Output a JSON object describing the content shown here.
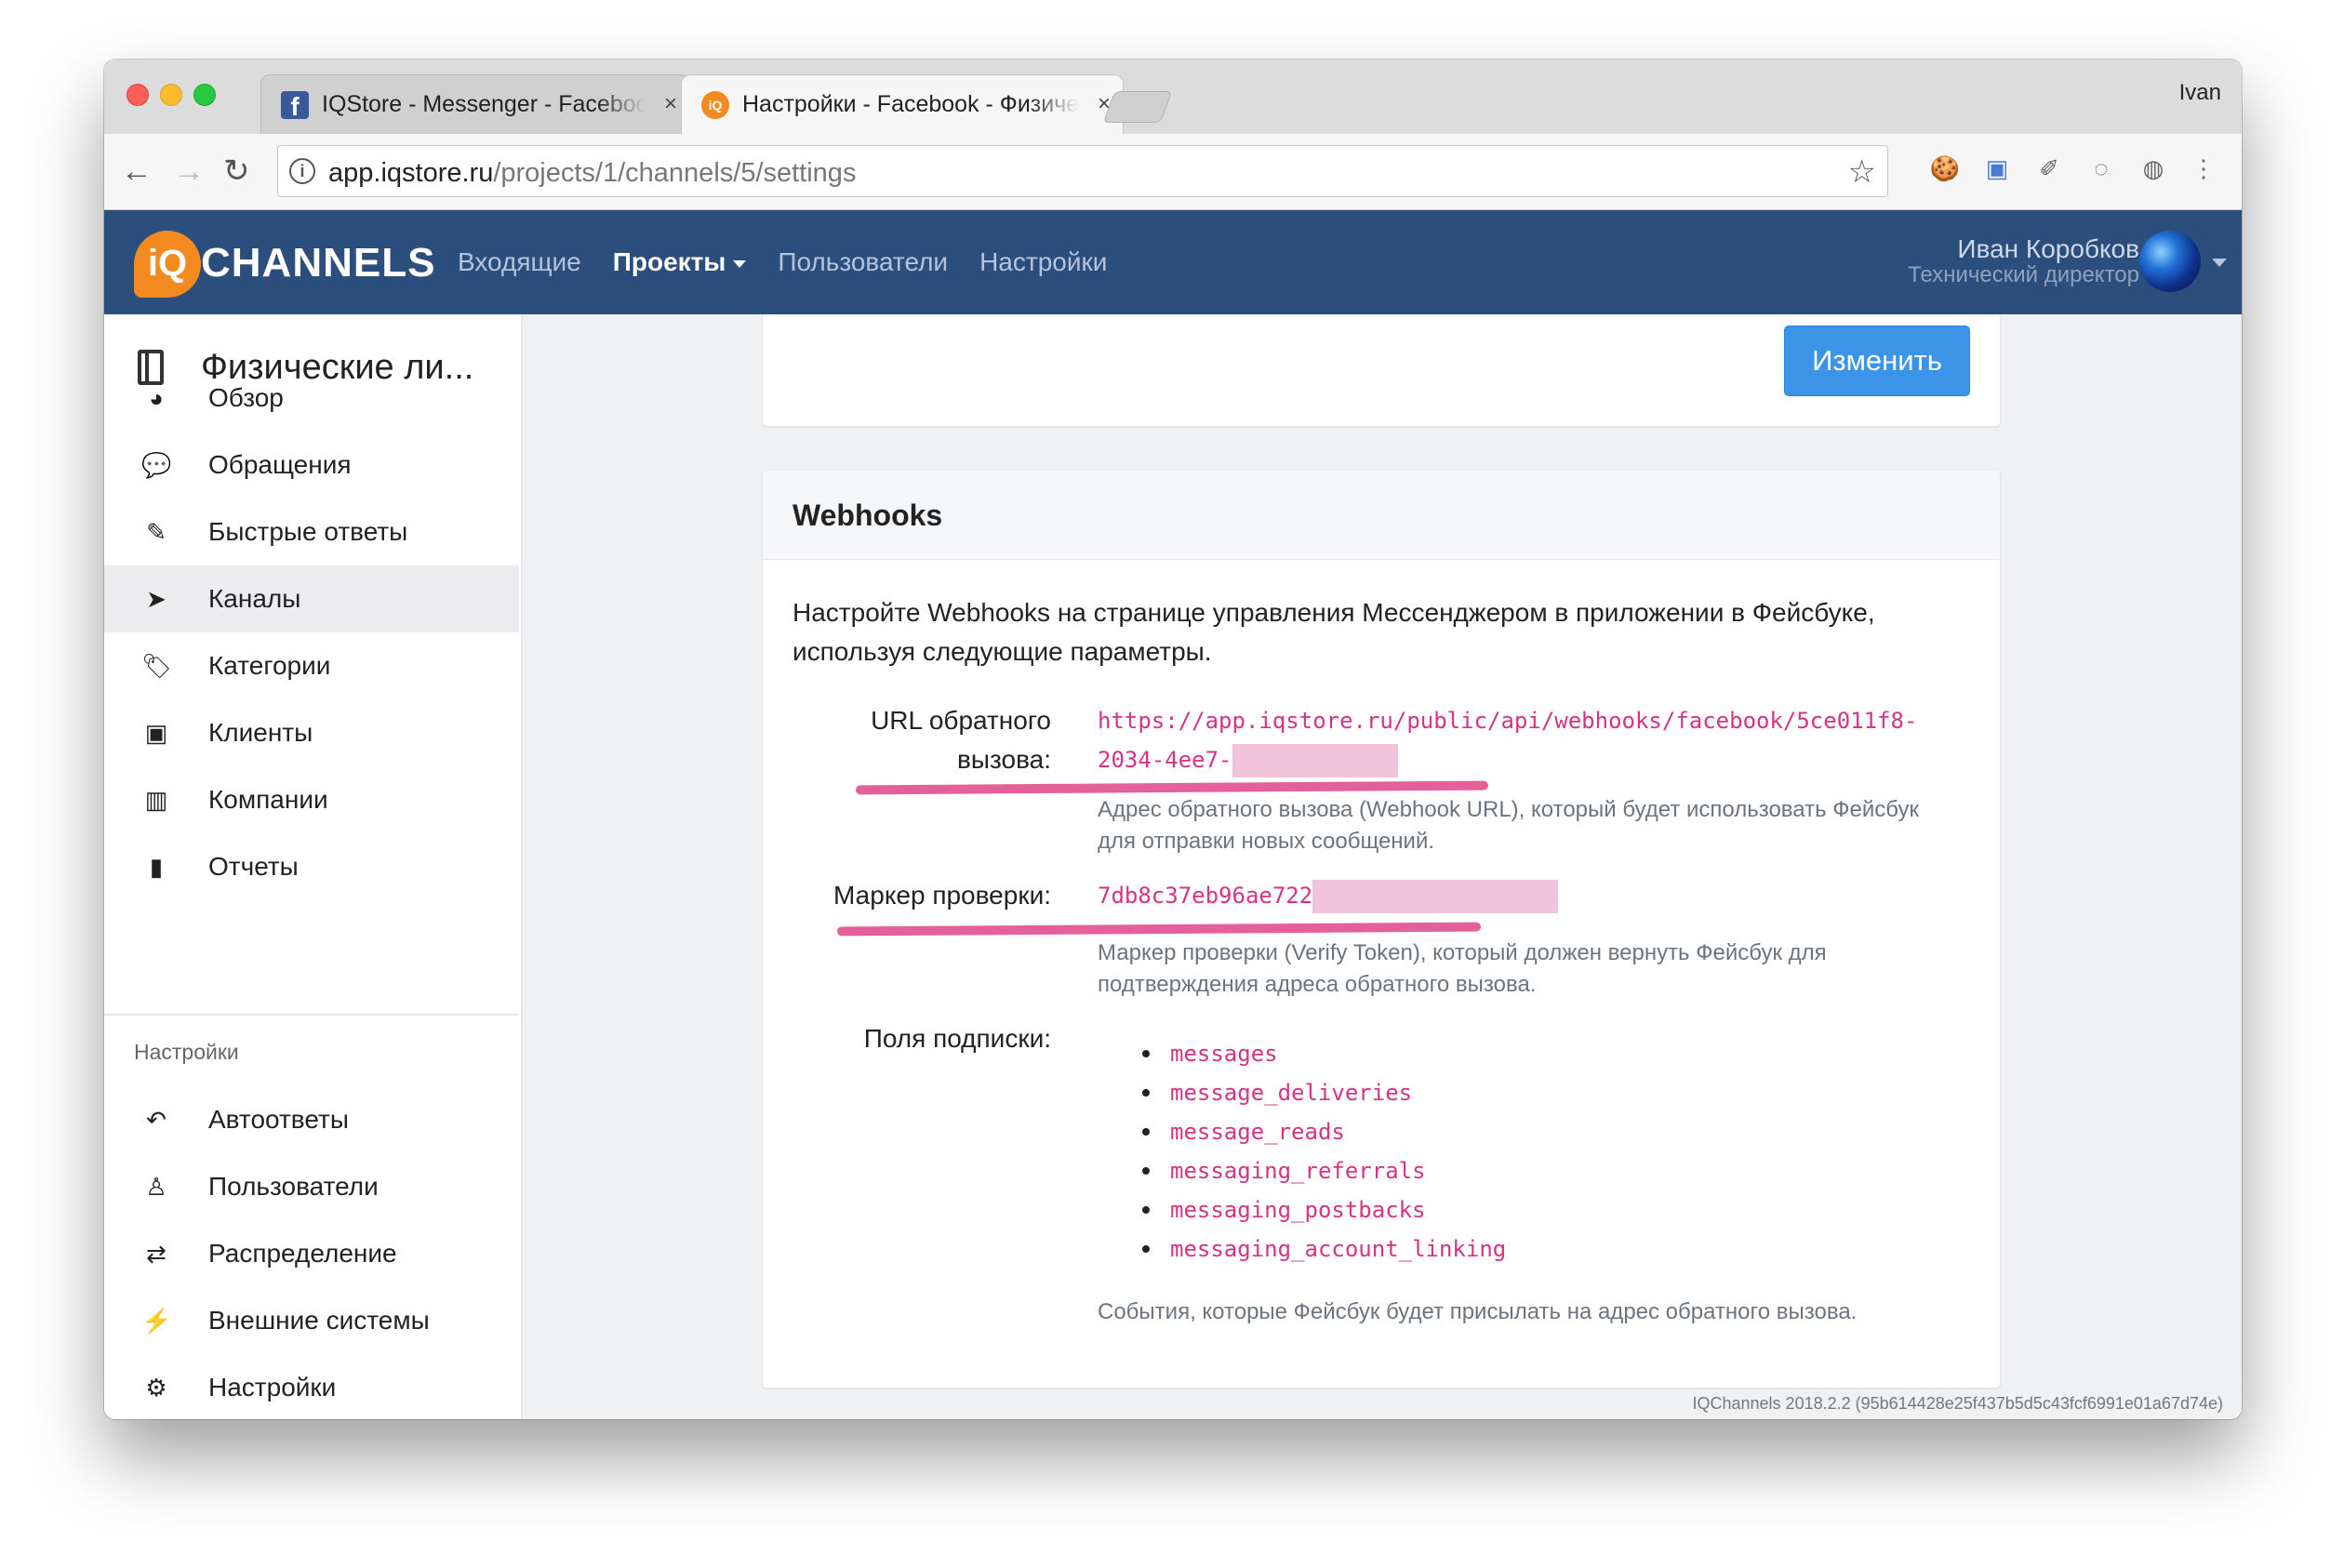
{
  "browser": {
    "tabs": [
      {
        "title": "IQStore - Messenger - Facebook",
        "close": "×"
      },
      {
        "title": "Настройки - Facebook - Физические лица",
        "close": "×"
      }
    ],
    "profile_name": "Ivan",
    "url_host": "app.iqstore.ru",
    "url_path": "/projects/1/channels/5/settings",
    "nav": {
      "back": "←",
      "forward": "→",
      "reload": "↻",
      "info": "i",
      "star": "☆"
    },
    "extensions": [
      "cookie-icon",
      "translate-icon",
      "notes-icon",
      "code-icon",
      "globe-icon",
      "more-icon"
    ]
  },
  "header": {
    "brand_mark": "iQ",
    "brand_text": "CHANNELS",
    "menu": [
      "Входящие",
      "Проекты",
      "Пользователи",
      "Настройки"
    ],
    "user_name": "Иван Коробков",
    "user_role": "Технический директор"
  },
  "sidebar": {
    "title": "Физические ли...",
    "items": [
      {
        "label": "Обзор",
        "icon": "dashboard-icon",
        "glyph": "◕"
      },
      {
        "label": "Обращения",
        "icon": "chat-icon",
        "glyph": "💬"
      },
      {
        "label": "Быстрые ответы",
        "icon": "edit-icon",
        "glyph": "✎"
      },
      {
        "label": "Каналы",
        "icon": "paper-plane-icon",
        "glyph": "➤"
      },
      {
        "label": "Категории",
        "icon": "tags-icon",
        "glyph": "🏷"
      },
      {
        "label": "Клиенты",
        "icon": "contact-card-icon",
        "glyph": "▣"
      },
      {
        "label": "Компании",
        "icon": "building-icon",
        "glyph": "▥"
      },
      {
        "label": "Отчеты",
        "icon": "bar-chart-icon",
        "glyph": "▮"
      }
    ],
    "settings_section": "Настройки",
    "settings_items": [
      {
        "label": "Автоответы",
        "icon": "reply-all-icon",
        "glyph": "↶"
      },
      {
        "label": "Пользователи",
        "icon": "user-icon",
        "glyph": "♙"
      },
      {
        "label": "Распределение",
        "icon": "exchange-icon",
        "glyph": "⇄"
      },
      {
        "label": "Внешние системы",
        "icon": "plug-icon",
        "glyph": "⚡"
      },
      {
        "label": "Настройки",
        "icon": "gear-icon",
        "glyph": "⚙"
      }
    ]
  },
  "top_card": {
    "edit_button": "Изменить"
  },
  "webhooks": {
    "title": "Webhooks",
    "intro": "Настройте Webhooks на странице управления Мессенджером в приложении в Фейсбуке, используя следующие параметры.",
    "callback_label_1": "URL обратного",
    "callback_label_2": "вызова:",
    "callback_url_line1": "https://app.iqstore.ru/public/api/webhooks/facebook/5ce011f8-",
    "callback_url_line2": "2034-4ee7-",
    "callback_help": "Адрес обратного вызова (Webhook URL), который будет использовать Фейсбук для отправки новых сообщений.",
    "verify_label": "Маркер проверки:",
    "verify_token": "7db8c37eb96ae722",
    "verify_help": "Маркер проверки (Verify Token), который должен вернуть Фейсбук для подтверждения адреса обратного вызова.",
    "fields_label": "Поля подписки:",
    "fields": [
      "messages",
      "message_deliveries",
      "message_reads",
      "messaging_referrals",
      "messaging_postbacks",
      "messaging_account_linking"
    ],
    "fields_help": "События, которые Фейсбук будет присылать на адрес обратного вызова."
  },
  "footer": {
    "version": "IQChannels 2018.2.2 (95b614428e25f437b5d5c43fcf6991e01a67d74e)"
  },
  "colors": {
    "nav_bg": "#2c4e7c",
    "brand_orange": "#f28a1f",
    "code_pink": "#d63384",
    "button_blue": "#3b94e8",
    "highlight": "#e4609b"
  }
}
